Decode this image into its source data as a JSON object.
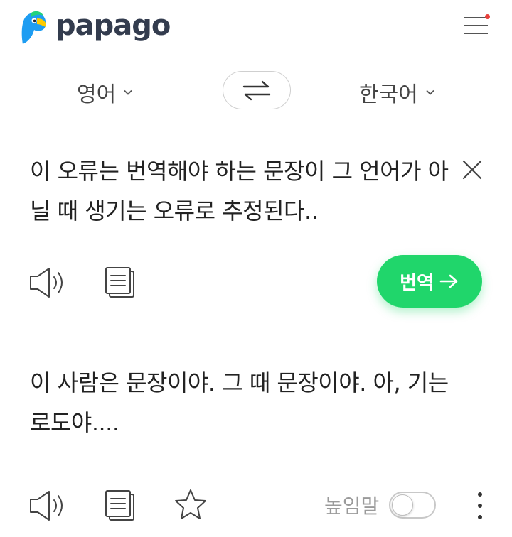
{
  "app": {
    "name": "papago"
  },
  "header": {
    "menu_has_notification": true
  },
  "languages": {
    "source": "영어",
    "target": "한국어"
  },
  "source": {
    "text": "이 오류는 번역해야 하는 문장이 그 언어가 아닐 때 생기는 오류로 추정된다.."
  },
  "actions": {
    "translate_label": "번역"
  },
  "result": {
    "text": "이 사람은 문장이야. 그 때 문장이야. 아, 기는 로도야...."
  },
  "options": {
    "honorific_label": "높임말",
    "honorific_on": false
  },
  "colors": {
    "accent": "#20d66b",
    "logo_text": "#333c4e",
    "notification": "#e8413c"
  },
  "icons": {
    "logo": "papago-parrot-icon",
    "menu": "hamburger-menu-icon",
    "swap": "swap-arrows-icon",
    "chevron": "chevron-down-icon",
    "clear": "close-icon",
    "speaker": "speaker-icon",
    "copy": "copy-icon",
    "star": "star-icon",
    "arrow": "arrow-right-icon",
    "more": "more-vertical-icon"
  }
}
